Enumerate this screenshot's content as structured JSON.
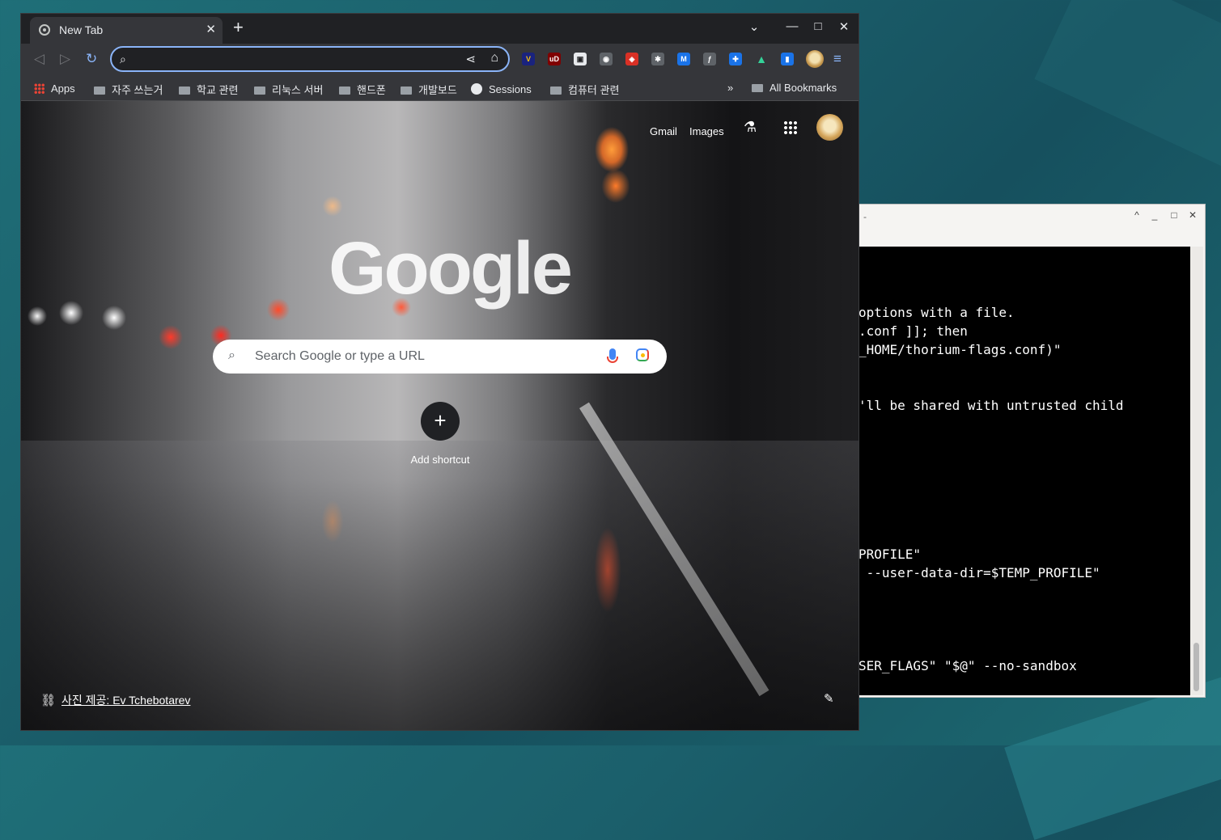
{
  "terminal": {
    "title": "-",
    "controls": [
      "^",
      "□",
      "✕"
    ],
    "lines": [
      "options with a file.",
      ".conf ]]; then",
      "_HOME/thorium-flags.conf)\"",
      "'ll be shared with untrusted child",
      "PROFILE\"",
      " --user-data-dir=$TEMP_PROFILE\"",
      "SER_FLAGS\" \"$@\" --no-sandbox"
    ]
  },
  "browser": {
    "tab_title": "New Tab",
    "tab_close": "✕",
    "new_tab": "+",
    "window_controls": [
      "⌄",
      "—",
      "□",
      "✕"
    ],
    "nav": {
      "back": "◁",
      "forward": "▷",
      "reload": "↻"
    },
    "omnibox": {
      "value": "",
      "search_icon": "search-icon",
      "share": "⋘",
      "bookmark": "☐"
    },
    "extensions": [
      {
        "name": "ext-1-icon",
        "color": "#f4c20d",
        "glyph": "V"
      },
      {
        "name": "ublock-icon",
        "color": "#800000",
        "glyph": "uD"
      },
      {
        "name": "pip-icon",
        "color": "#5f6368",
        "glyph": "▣"
      },
      {
        "name": "camera-icon",
        "color": "#5f6368",
        "glyph": "◉"
      },
      {
        "name": "ext-5-icon",
        "color": "#d93025",
        "glyph": "◈"
      },
      {
        "name": "ext-6-icon",
        "color": "#5f6368",
        "glyph": "✱"
      },
      {
        "name": "ext-7-icon",
        "color": "#1a73e8",
        "glyph": "M"
      },
      {
        "name": "ext-8-icon",
        "color": "#5f6368",
        "glyph": "ƒ"
      },
      {
        "name": "puzzle-icon",
        "color": "#1a73e8",
        "glyph": "✚"
      },
      {
        "name": "flask-icon",
        "color": "#34d399",
        "glyph": "▲"
      },
      {
        "name": "sidepanel-icon",
        "color": "#1a73e8",
        "glyph": "▮"
      }
    ],
    "menu": "≡",
    "bookmarks": {
      "items": [
        "Apps",
        "자주 쓰는거",
        "학교 관련",
        "리눅스 서버",
        "핸드폰",
        "개발보드",
        "Sessions",
        "컴퓨터 관련"
      ],
      "overflow": "»",
      "all_bookmarks": "All Bookmarks"
    },
    "ntp": {
      "gmail": "Gmail",
      "images": "Images",
      "logo": "Google",
      "search_placeholder": "Search Google or type a URL",
      "add_shortcut": "Add shortcut",
      "add_symbol": "+",
      "credit": "사진 제공: Ev Tchebotarev",
      "edit": "✎",
      "link_icon": "⛓"
    }
  }
}
